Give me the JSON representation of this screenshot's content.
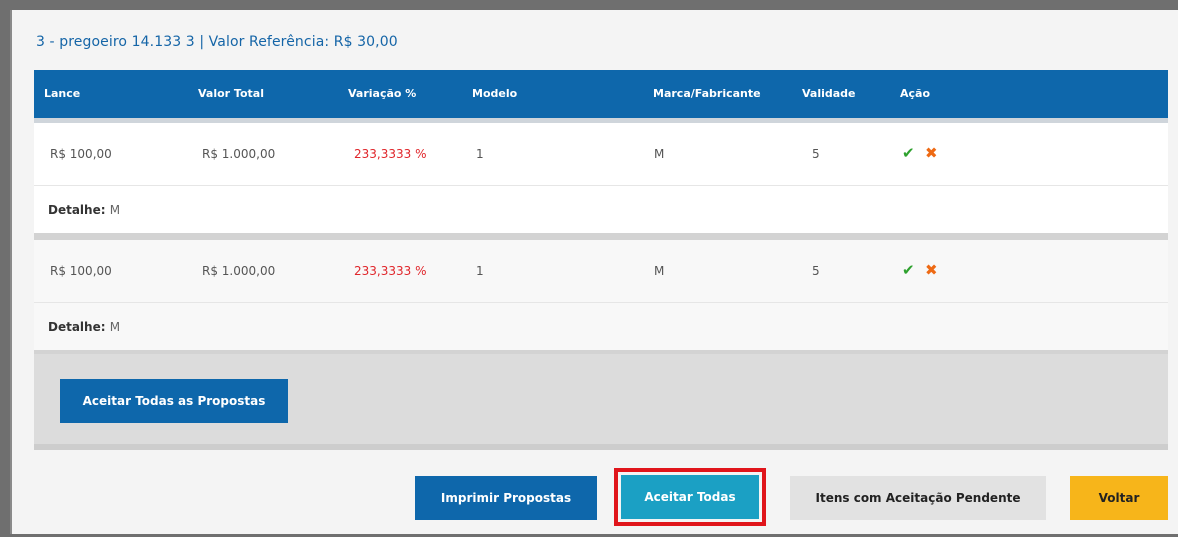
{
  "title": "3 - pregoeiro 14.133 3 | Valor Referência: R$ 30,00",
  "columns": [
    "Lance",
    "Valor Total",
    "Variação %",
    "Modelo",
    "Marca/Fabricante",
    "Validade",
    "Ação"
  ],
  "rows": [
    {
      "lance": "R$ 100,00",
      "valor_total": "R$ 1.000,00",
      "variacao": "233,3333 %",
      "modelo": "1",
      "marca": "M",
      "validade": "5",
      "detalhe_label": "Detalhe:",
      "detalhe_value": "M"
    },
    {
      "lance": "R$ 100,00",
      "valor_total": "R$ 1.000,00",
      "variacao": "233,3333 %",
      "modelo": "1",
      "marca": "M",
      "validade": "5",
      "detalhe_label": "Detalhe:",
      "detalhe_value": "M"
    }
  ],
  "icons": {
    "accept": "check-icon",
    "reject": "close-icon",
    "accept_glyph": "✔",
    "reject_glyph": "✖"
  },
  "buttons": {
    "aceitar_todas_propostas": "Aceitar Todas as Propostas",
    "imprimir": "Imprimir Propostas",
    "aceitar_todas": "Aceitar Todas",
    "pendentes": "Itens com Aceitação Pendente",
    "voltar": "Voltar"
  },
  "colors": {
    "primary": "#0e67ab",
    "teal": "#1ba0c4",
    "warning": "#f7b51a",
    "highlight": "#e0151b",
    "variation": "#e0262b",
    "accept": "#2ea12e",
    "reject": "#ee6a14"
  }
}
